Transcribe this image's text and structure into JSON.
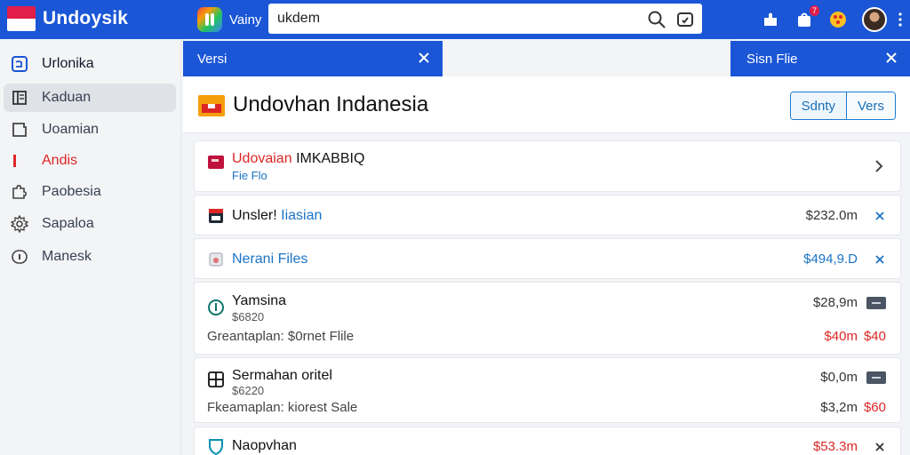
{
  "brand": {
    "name": "Undoysik"
  },
  "app": {
    "label": "Vainy"
  },
  "search": {
    "value": "ukdem"
  },
  "top_icons": {
    "notification_count": "7"
  },
  "sidebar": {
    "items": [
      {
        "label": "Urlonika",
        "icon": "window-icon"
      },
      {
        "label": "Kaduan",
        "icon": "book-icon"
      },
      {
        "label": "Uoamian",
        "icon": "folder-icon"
      },
      {
        "label": "Andis",
        "icon": "bar-icon"
      },
      {
        "label": "Paobesia",
        "icon": "puzzle-icon"
      },
      {
        "label": "Sapaloa",
        "icon": "gear-icon"
      },
      {
        "label": "Manesk",
        "icon": "info-icon"
      }
    ]
  },
  "tabs": {
    "left": "Versi",
    "right": "Sisn Flie"
  },
  "header": {
    "title": "Undovhan Indanesia",
    "btn_primary": "Sdnty",
    "btn_secondary": "Vers"
  },
  "rows": [
    {
      "title_a": "Udovaian",
      "title_b": "IMKABBIQ",
      "sub": "Fie Flo"
    },
    {
      "title_a": "Unsler!",
      "title_b": "Iiasian",
      "amount": "$232.0m"
    },
    {
      "title": "Nerani Files",
      "amount": "$494,9.D"
    },
    {
      "title": "Yamsina",
      "sub": "$6820",
      "desc": "Greantaplan: $0rnet Flile",
      "amount": "$28,9m",
      "amount2": "$40m",
      "tag": "$40"
    },
    {
      "title": "Sermahan oritel",
      "sub": "$6220",
      "desc": "Fkeamaplan: kiorest Sale",
      "amount": "$0,0m",
      "amount2": "$3,2m",
      "tag": "$60"
    },
    {
      "title": "Naopvhan",
      "amount": "$53.3m"
    }
  ],
  "colors": {
    "accent": "#1a56d6",
    "danger": "#dc2626",
    "link": "#1a73c7"
  }
}
